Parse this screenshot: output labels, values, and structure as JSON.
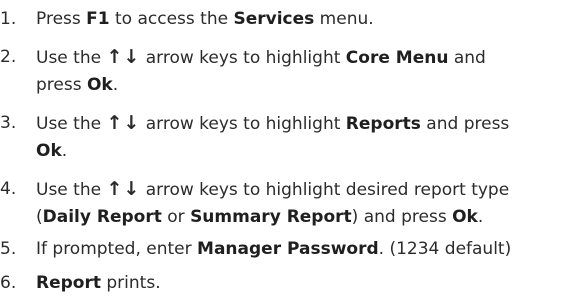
{
  "steps": [
    {
      "number": "1.",
      "t0": "Press ",
      "b0": "F1",
      "t1": " to access the ",
      "b1": "Services",
      "t2": " menu."
    },
    {
      "number": "2.",
      "t0": "Use the ",
      "arrows": "↑↓",
      "t1": " arrow keys to highlight ",
      "b0": "Core Menu",
      "t2": " and",
      "t3": "press ",
      "b1": "Ok",
      "t4": "."
    },
    {
      "number": "3.",
      "t0": "Use the ",
      "arrows": "↑↓",
      "t1": " arrow keys to highlight ",
      "b0": "Reports",
      "t2": " and press",
      "b1": "Ok",
      "t3": "."
    },
    {
      "number": "4.",
      "t0": "Use the ",
      "arrows": "↑↓",
      "t1": " arrow keys to highlight desired report type",
      "t2": "(",
      "b0": "Daily Report",
      "t3": " or ",
      "b1": "Summary Report",
      "t4": ") and press ",
      "b2": "Ok",
      "t5": "."
    },
    {
      "number": "5.",
      "t0": "If prompted, enter ",
      "b0": "Manager Password",
      "t1": ". (1234 default)"
    },
    {
      "number": "6.",
      "b0": "Report",
      "t0": " prints."
    }
  ]
}
